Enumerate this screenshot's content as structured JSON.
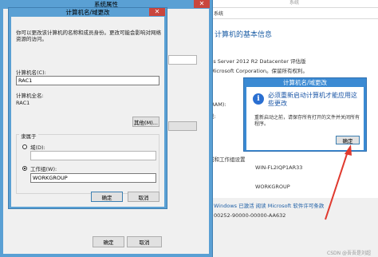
{
  "background_window": {
    "title": "系统",
    "address": "系统",
    "heading": "计算机的基本信息",
    "lines": [
      "ws Server 2012 R2 Datacenter 评估版",
      "Microsoft Corporation。保留所有权利。",
      "(RAM):",
      "型:",
      "",
      "域和工作组设置",
      "",
      "WIN-FL2IQP1AR33",
      "",
      "WORKGROUP",
      "",
      "Windows 已激活    阅读 Microsoft 软件许可条款",
      "00252-90000-00000-AA632"
    ]
  },
  "system_properties": {
    "title": "系统属性",
    "close_glyph": "✕",
    "ok_label": "确定",
    "cancel_label": "取消"
  },
  "computer_name_dialog": {
    "title": "计算机名/域更改",
    "close_glyph": "✕",
    "description": "你可以更改该计算机的名称和成员身份。更改可能会影响对网络资源的访问。",
    "computer_name_label": "计算机名(C):",
    "computer_name_value": "RAC1",
    "full_name_label": "计算机全名:",
    "full_name_value": "RAC1",
    "other_button": "其他(M)...",
    "member_of_label": "隶属于",
    "domain_label": "域(D):",
    "domain_value": "",
    "workgroup_label": "工作组(W):",
    "workgroup_value": "WORKGROUP",
    "workgroup_selected": true,
    "ok_label": "确定",
    "cancel_label": "取消"
  },
  "restart_notice": {
    "title": "计算机名/域更改",
    "icon": "info-icon",
    "icon_glyph": "i",
    "heading": "必须重新启动计算机才能应用这些更改",
    "body": "重新启动之前，请保存所有打开的文件并关闭所有程序。",
    "ok_label": "确定"
  },
  "annotation": {
    "arrow_color": "#e03a2f"
  },
  "watermark": "CSDN @吾吾是刘超"
}
